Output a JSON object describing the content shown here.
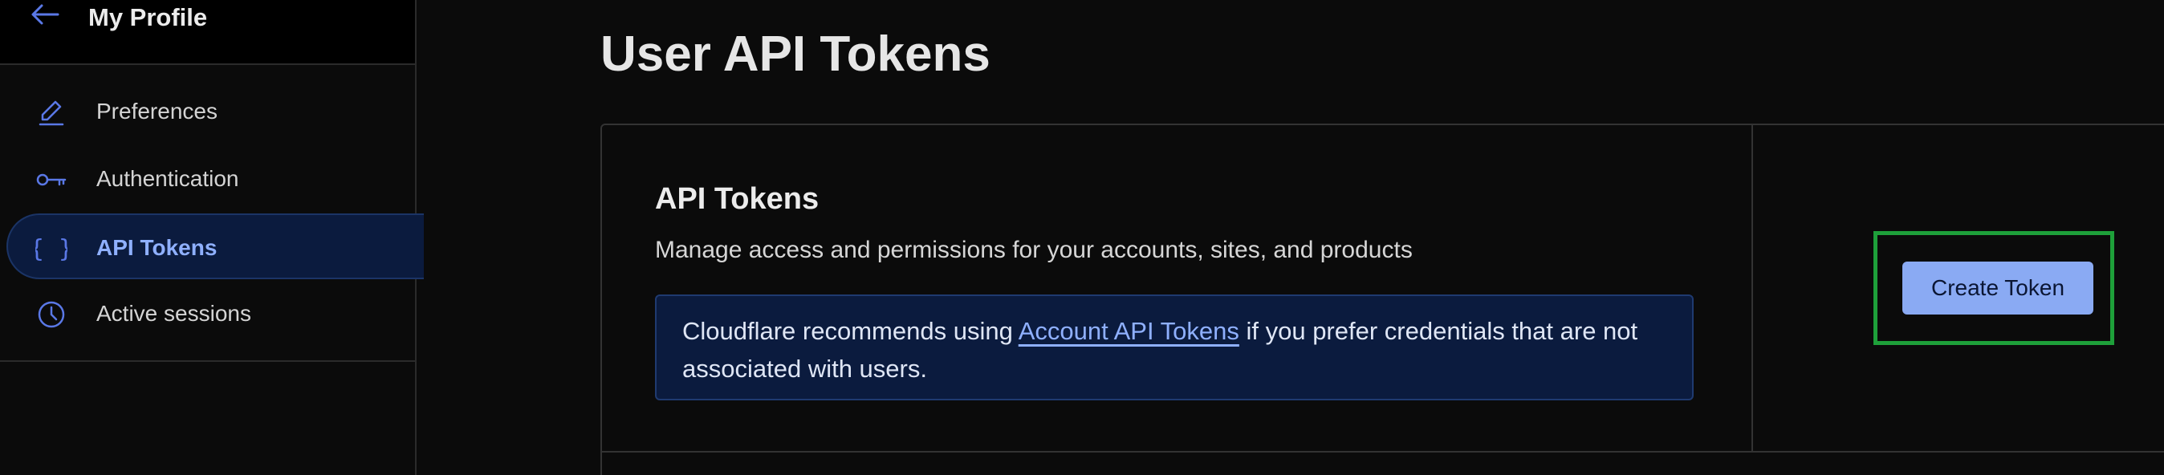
{
  "sidebar": {
    "title": "My Profile",
    "items": [
      {
        "label": "Preferences",
        "icon": "pencil-icon"
      },
      {
        "label": "Authentication",
        "icon": "key-icon"
      },
      {
        "label": "API Tokens",
        "icon": "braces-icon",
        "active": true
      },
      {
        "label": "Active sessions",
        "icon": "clock-icon"
      }
    ]
  },
  "main": {
    "page_title": "User API Tokens",
    "card": {
      "title": "API Tokens",
      "description": "Manage access and permissions for your accounts, sites, and products",
      "info": {
        "before": "Cloudflare recommends using ",
        "link": "Account API Tokens",
        "after": " if you prefer credentials that are not associated with users."
      },
      "create_button": "Create Token"
    }
  },
  "colors": {
    "accent": "#8fb0ff",
    "active_bg": "#0b1b3e",
    "highlight": "#1ea03a",
    "button_bg": "#8aaaf3"
  }
}
